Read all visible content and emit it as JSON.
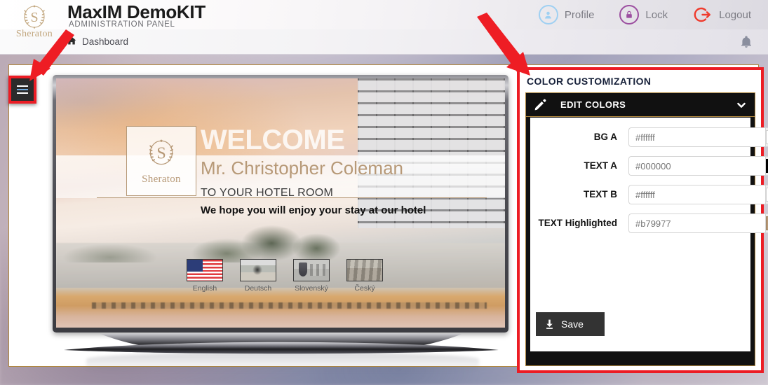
{
  "header": {
    "brand": "Sheraton",
    "title": "MaxIM DemoKIT",
    "subtitle": "ADMINISTRATION PANEL",
    "actions": [
      {
        "label": "Profile",
        "icon": "profile-icon",
        "color": "#9fd0f2"
      },
      {
        "label": "Lock",
        "icon": "lock-icon",
        "color": "#9c4fa0"
      },
      {
        "label": "Logout",
        "icon": "logout-icon",
        "color": "#ef3b2d"
      }
    ]
  },
  "subheader": {
    "breadcrumb": "Dashboard",
    "home_icon": "home-icon",
    "bell_icon": "bell-icon"
  },
  "sidebar_toggle": {
    "icon": "hamburger-icon",
    "label": ""
  },
  "tv_preview": {
    "logo_text": "Sheraton",
    "welcome": "WELCOME",
    "guest_name": "Mr. Christopher Coleman",
    "to_room": "TO YOUR HOTEL ROOM",
    "hope_text": "We hope you will enjoy your stay at our hotel",
    "next_icon": "chevron-right-icon",
    "languages": [
      {
        "name": "English",
        "flag": "us"
      },
      {
        "name": "Deutsch",
        "flag": "de"
      },
      {
        "name": "Slovenský",
        "flag": "sk"
      },
      {
        "name": "Český",
        "flag": "cz"
      }
    ]
  },
  "color_panel": {
    "title": "COLOR CUSTOMIZATION",
    "widget_title": "EDIT COLORS",
    "widget_icon": "pencil-icon",
    "collapse_icon": "chevron-down-icon",
    "fields": [
      {
        "label": "BG A",
        "value": "#ffffff",
        "swatch": "#ffffff"
      },
      {
        "label": "TEXT A",
        "value": "#000000",
        "swatch": "#000000"
      },
      {
        "label": "TEXT B",
        "value": "#ffffff",
        "swatch": "#ffffff"
      },
      {
        "label": "TEXT Highlighted",
        "value": "#b79977",
        "swatch": "#b79977"
      }
    ],
    "save_label": "Save",
    "save_icon": "download-icon"
  },
  "annotations": {
    "highlight_color": "#ec1c24",
    "arrows": 2
  }
}
